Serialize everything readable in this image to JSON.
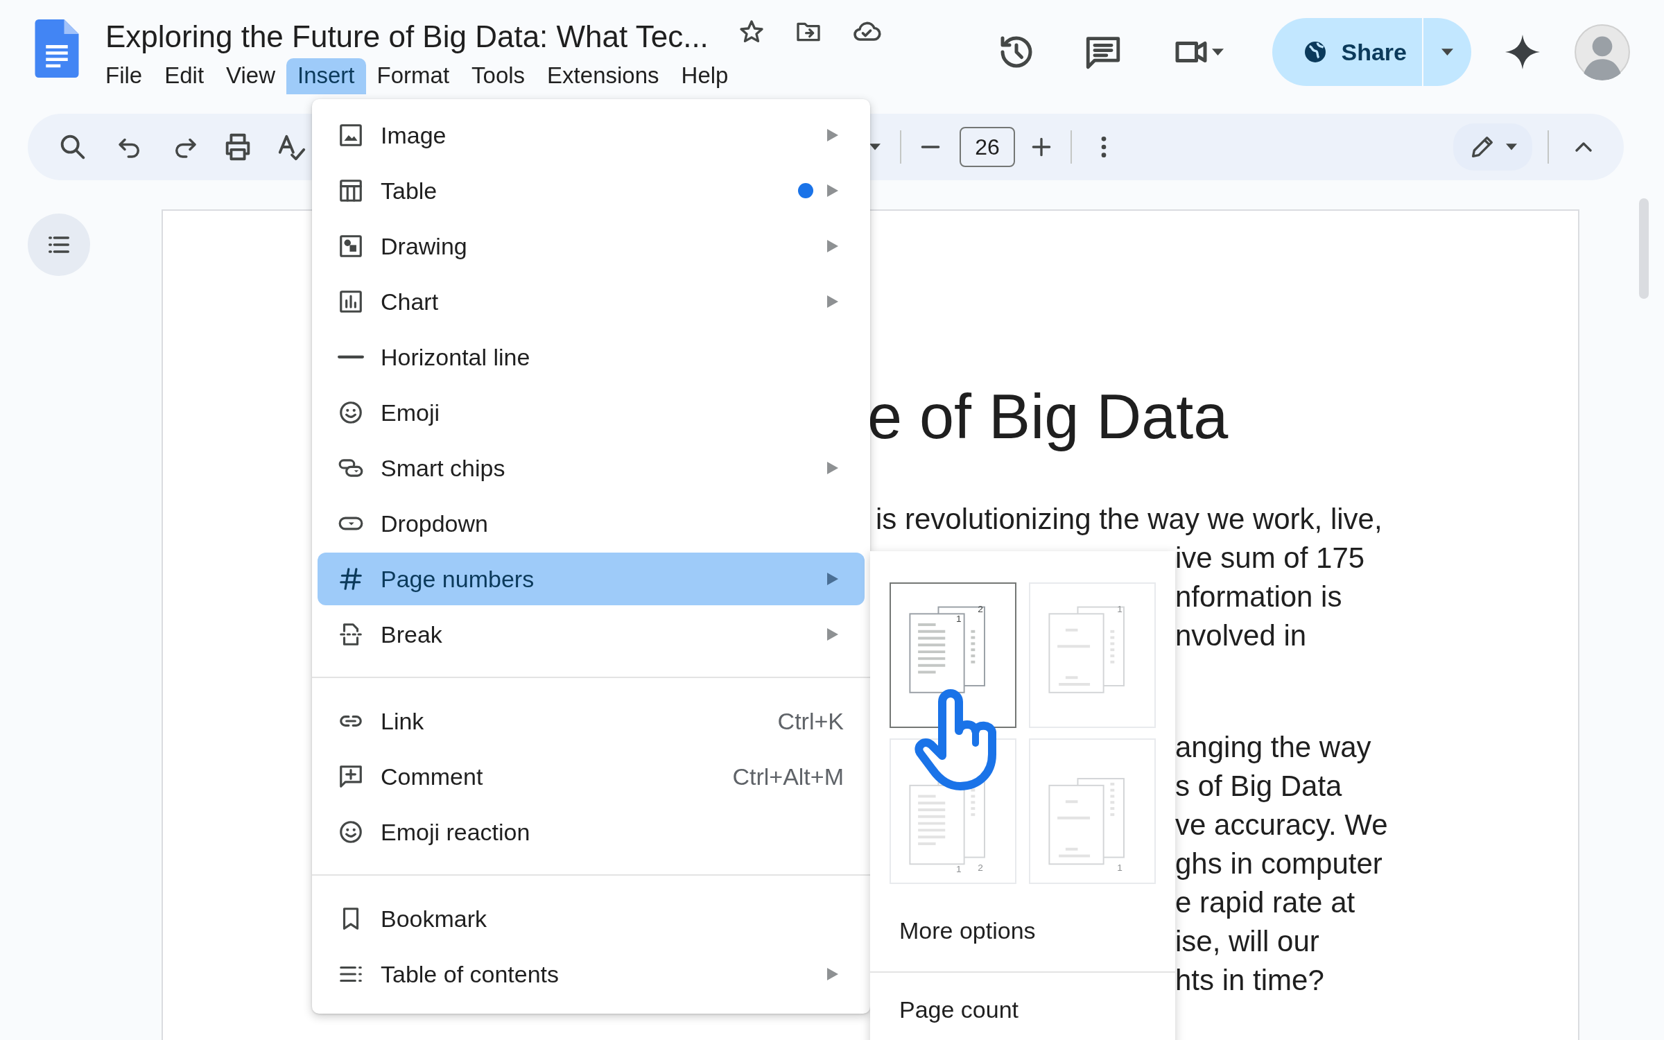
{
  "document": {
    "title": "Exploring the Future of Big Data: What Tec..."
  },
  "menubar": [
    {
      "label": "File",
      "selected": false
    },
    {
      "label": "Edit",
      "selected": false
    },
    {
      "label": "View",
      "selected": false
    },
    {
      "label": "Insert",
      "selected": true
    },
    {
      "label": "Format",
      "selected": false
    },
    {
      "label": "Tools",
      "selected": false
    },
    {
      "label": "Extensions",
      "selected": false
    },
    {
      "label": "Help",
      "selected": false
    }
  ],
  "share": {
    "label": "Share"
  },
  "toolbar": {
    "font_size": "26"
  },
  "page": {
    "heading": "e of Big Data",
    "paragraphs": [
      {
        "lines": [
          "is revolutionizing the way we work, live,",
          "ive sum of 175",
          "nformation is",
          "nvolved in"
        ]
      },
      {
        "lines": [
          "anging the way",
          "s of Big Data",
          "ve accuracy. We",
          "ghs in computer",
          "e rapid rate at",
          "ise, will our",
          "hts in time?"
        ]
      }
    ]
  },
  "insert_menu": {
    "sections": [
      [
        {
          "label": "Image",
          "submenu": true,
          "new": false,
          "selected": false
        },
        {
          "label": "Table",
          "submenu": true,
          "new": true,
          "selected": false
        },
        {
          "label": "Drawing",
          "submenu": true,
          "new": false,
          "selected": false
        },
        {
          "label": "Chart",
          "submenu": true,
          "new": false,
          "selected": false
        },
        {
          "label": "Horizontal line",
          "submenu": false,
          "new": false,
          "selected": false
        },
        {
          "label": "Emoji",
          "submenu": false,
          "new": false,
          "selected": false
        },
        {
          "label": "Smart chips",
          "submenu": true,
          "new": false,
          "selected": false
        },
        {
          "label": "Dropdown",
          "submenu": false,
          "new": false,
          "selected": false
        },
        {
          "label": "Page numbers",
          "submenu": true,
          "new": false,
          "selected": true
        },
        {
          "label": "Break",
          "submenu": true,
          "new": false,
          "selected": false
        }
      ],
      [
        {
          "label": "Link",
          "shortcut": "Ctrl+K",
          "submenu": false,
          "new": false,
          "selected": false
        },
        {
          "label": "Comment",
          "shortcut": "Ctrl+Alt+M",
          "submenu": false,
          "new": false,
          "selected": false
        },
        {
          "label": "Emoji reaction",
          "submenu": false,
          "new": false,
          "selected": false
        }
      ],
      [
        {
          "label": "Bookmark",
          "submenu": false,
          "new": false,
          "selected": false
        },
        {
          "label": "Table of contents",
          "submenu": true,
          "new": false,
          "selected": false
        }
      ]
    ]
  },
  "page_numbers_submenu": {
    "options": [
      {
        "kind": "header",
        "labels": [
          "1",
          "2"
        ],
        "selected": true
      },
      {
        "kind": "header",
        "labels": [
          "1"
        ],
        "selected": false
      },
      {
        "kind": "footer",
        "labels": [
          "1",
          "2"
        ],
        "selected": false
      },
      {
        "kind": "footer",
        "labels": [
          "1"
        ],
        "selected": false
      }
    ],
    "items": [
      {
        "label": "More options"
      },
      {
        "label": "Page count"
      }
    ]
  }
}
